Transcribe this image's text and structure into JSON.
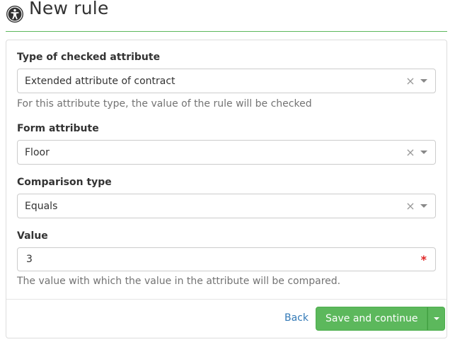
{
  "header": {
    "title": "New rule",
    "icon": "accessibility-icon"
  },
  "form": {
    "type_field": {
      "label": "Type of checked attribute",
      "value": "Extended attribute of contract",
      "clear": "×",
      "help": "For this attribute type, the value of the rule will be checked"
    },
    "form_attribute_field": {
      "label": "Form attribute",
      "value": "Floor",
      "clear": "×"
    },
    "comparison_field": {
      "label": "Comparison type",
      "value": "Equals",
      "clear": "×"
    },
    "value_field": {
      "label": "Value",
      "value": "3",
      "required_mark": "*",
      "help": "The value with which the value in the attribute will be compared."
    }
  },
  "footer": {
    "back_label": "Back",
    "save_label": "Save and continue"
  },
  "colors": {
    "primary_green": "#5cb85c",
    "link_blue": "#337ab7",
    "required_red": "#e02424"
  }
}
